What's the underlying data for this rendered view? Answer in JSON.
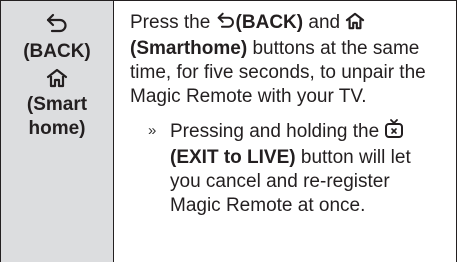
{
  "left_cell": {
    "back_icon": "back-arrow-icon",
    "back_label": "(BACK)",
    "home_icon": "home-icon",
    "home_label_line1": "(Smart",
    "home_label_line2": "home)"
  },
  "description": {
    "press_the": "Press the ",
    "back_icon": "back-arrow-icon",
    "back_bold": "(BACK)",
    "and": " and ",
    "home_icon": "home-icon",
    "home_bold": "(Smarthome)",
    "rest": " buttons at the same time, for five seconds, to unpair the Magic Remote with your TV."
  },
  "note": {
    "bullet": "»",
    "pressing_holding": "Pressing and holding the ",
    "exit_icon": "exit-to-live-icon",
    "exit_bold": "(EXIT to LIVE)",
    "rest": " button will let you cancel and re-register Magic Remote at once."
  },
  "colors": {
    "left_background": "#dcdddf",
    "border": "#231f20",
    "text": "#231f20"
  }
}
